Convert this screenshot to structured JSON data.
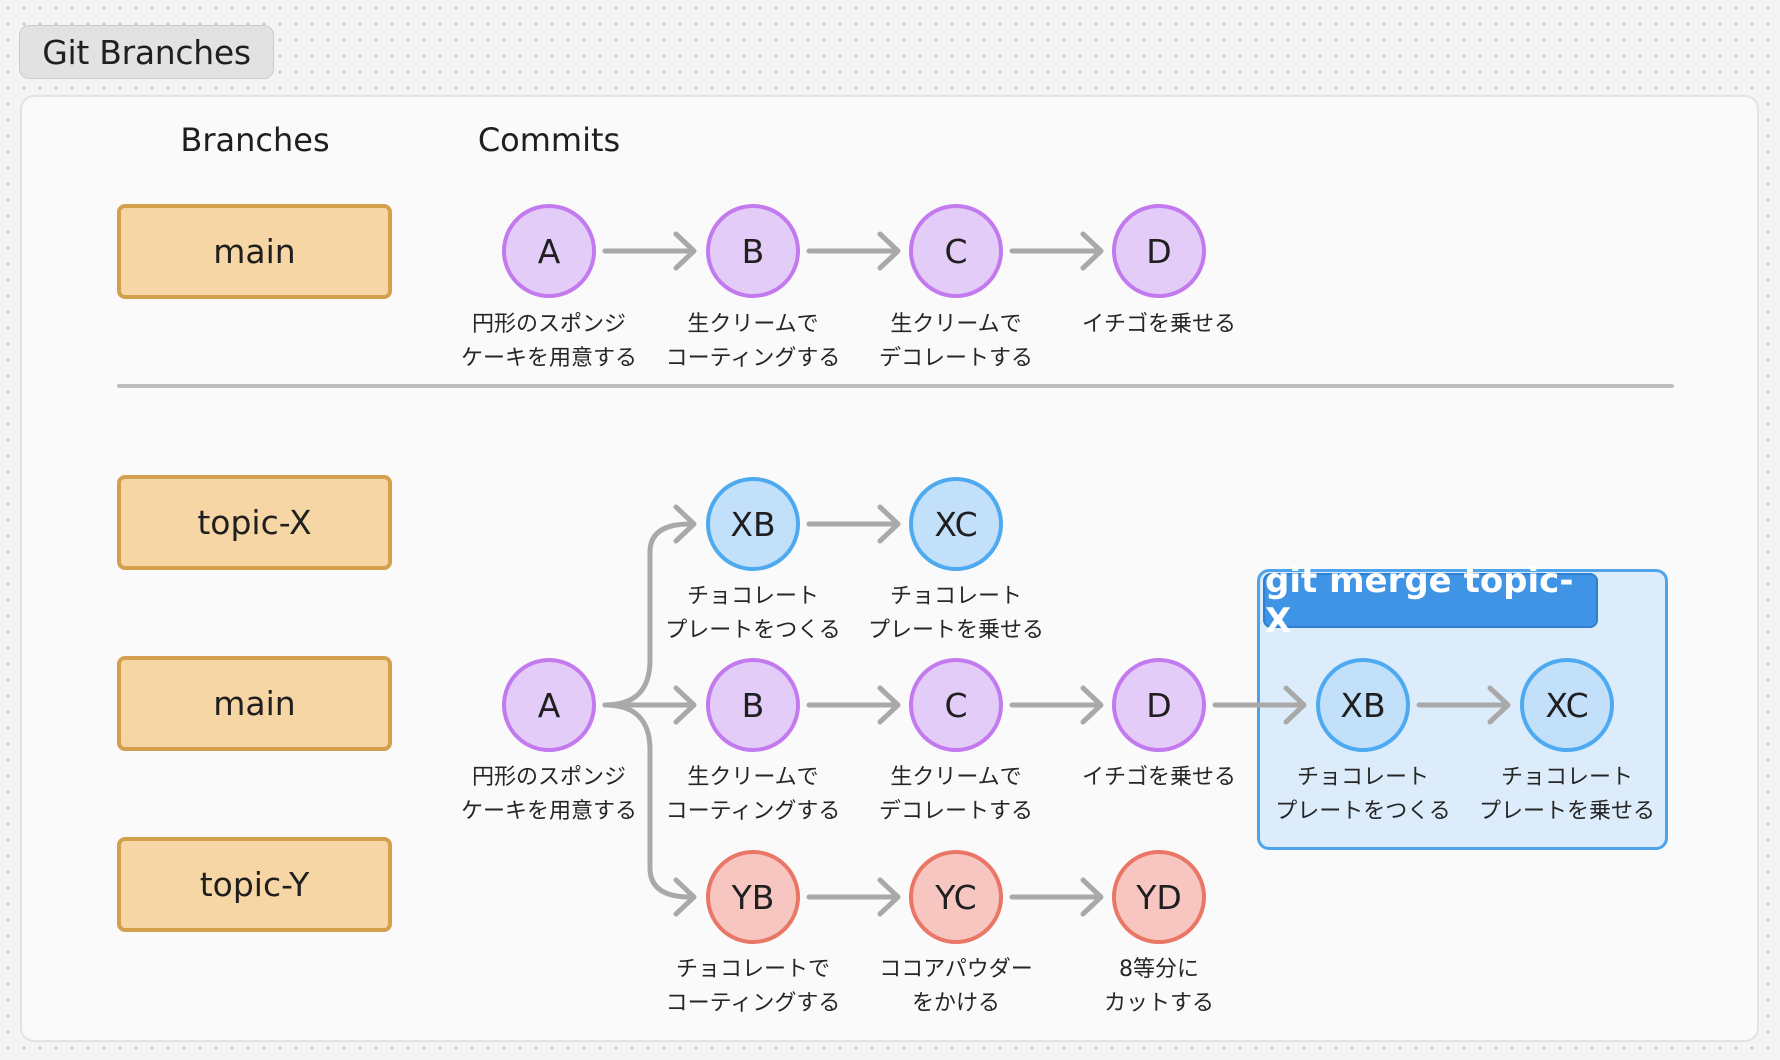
{
  "title": "Git Branches",
  "headers": {
    "branches": "Branches",
    "commits": "Commits"
  },
  "top": {
    "branch": "main",
    "commits": [
      {
        "id": "A",
        "desc": "円形のスポンジ\nケーキを用意する"
      },
      {
        "id": "B",
        "desc": "生クリームで\nコーティングする"
      },
      {
        "id": "C",
        "desc": "生クリームで\nデコレートする"
      },
      {
        "id": "D",
        "desc": "イチゴを乗せる"
      }
    ]
  },
  "bottom": {
    "branches": [
      "topic-X",
      "main",
      "topic-Y"
    ],
    "root": {
      "id": "A",
      "desc": "円形のスポンジ\nケーキを用意する"
    },
    "topic_x": [
      {
        "id": "XB",
        "desc": "チョコレート\nプレートをつくる"
      },
      {
        "id": "XC",
        "desc": "チョコレート\nプレートを乗せる"
      }
    ],
    "main": [
      {
        "id": "B",
        "desc": "生クリームで\nコーティングする"
      },
      {
        "id": "C",
        "desc": "生クリームで\nデコレートする"
      },
      {
        "id": "D",
        "desc": "イチゴを乗せる"
      }
    ],
    "topic_y": [
      {
        "id": "YB",
        "desc": "チョコレートで\nコーティングする"
      },
      {
        "id": "YC",
        "desc": "ココアパウダー\nをかける"
      },
      {
        "id": "YD",
        "desc": "8等分に\nカットする"
      }
    ],
    "merge": {
      "label": "git merge topic-X",
      "commits": [
        {
          "id": "XB",
          "desc": "チョコレート\nプレートをつくる"
        },
        {
          "id": "XC",
          "desc": "チョコレート\nプレートを乗せる"
        }
      ]
    }
  },
  "colors": {
    "main_commit": "#e3ccf7",
    "topic_x_commit": "#c3e0fb",
    "topic_y_commit": "#f8c6c1",
    "branch_box": "#f7d6a5",
    "merge_highlight": "#3f94e6"
  }
}
